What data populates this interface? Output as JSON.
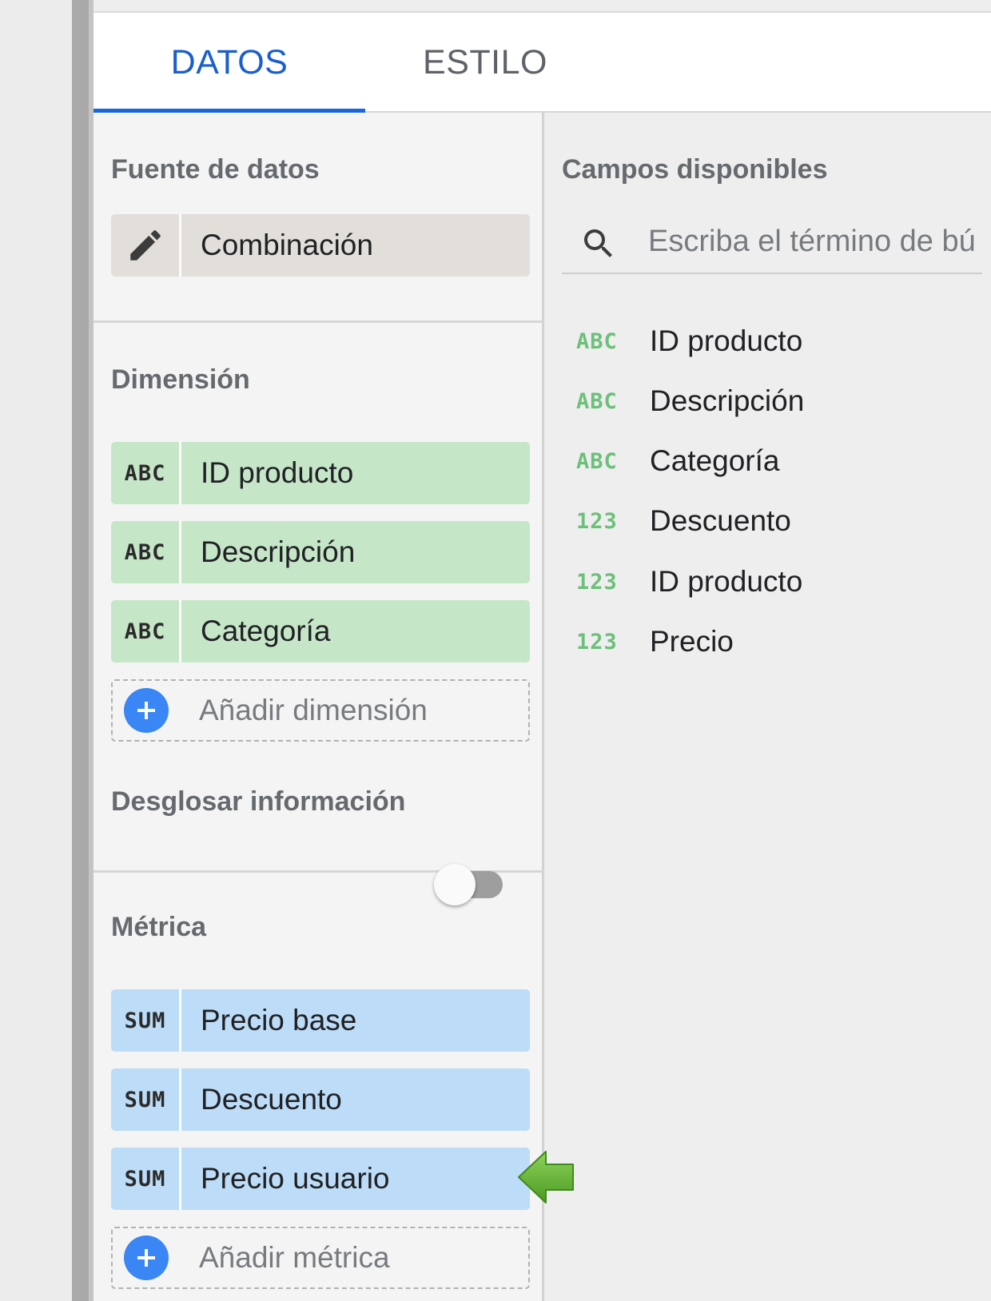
{
  "tabs": [
    {
      "label": "DATOS",
      "active": true
    },
    {
      "label": "ESTILO",
      "active": false
    }
  ],
  "data_source": {
    "title": "Fuente de datos",
    "icon": "pencil-icon",
    "name": "Combinación"
  },
  "dimension": {
    "title": "Dimensión",
    "items": [
      {
        "type": "ABC",
        "label": "ID producto"
      },
      {
        "type": "ABC",
        "label": "Descripción"
      },
      {
        "type": "ABC",
        "label": "Categoría"
      }
    ],
    "add_label": "Añadir dimensión"
  },
  "drilldown": {
    "title": "Desglosar información",
    "enabled": false
  },
  "metric": {
    "title": "Métrica",
    "items": [
      {
        "agg": "SUM",
        "label": "Precio base"
      },
      {
        "agg": "SUM",
        "label": "Descuento"
      },
      {
        "agg": "SUM",
        "label": "Precio usuario"
      }
    ],
    "add_label": "Añadir métrica"
  },
  "available_fields": {
    "title": "Campos disponibles",
    "search_placeholder": "Escriba el término de búsqueda",
    "items": [
      {
        "type": "ABC",
        "label": "ID producto"
      },
      {
        "type": "ABC",
        "label": "Descripción"
      },
      {
        "type": "ABC",
        "label": "Categoría"
      },
      {
        "type": "123",
        "label": "Descuento"
      },
      {
        "type": "123",
        "label": "ID producto"
      },
      {
        "type": "123",
        "label": "Precio"
      }
    ]
  },
  "colors": {
    "accent": "#1a66d9",
    "dimension_chip": "#c6e6c8",
    "metric_chip": "#bcdcf7",
    "source_chip": "#e2ded9",
    "annotation_arrow": "#5fae2e"
  }
}
